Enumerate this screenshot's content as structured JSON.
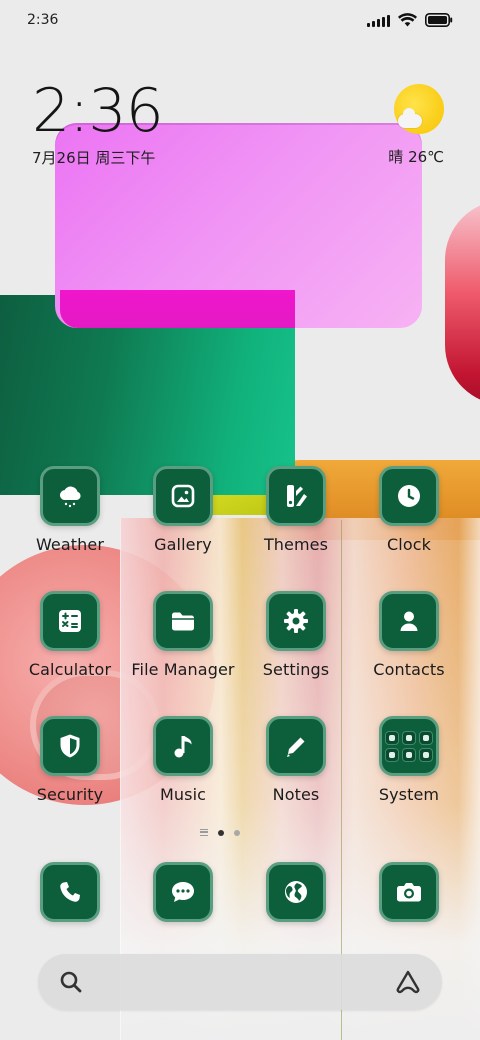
{
  "status_bar": {
    "time": "2:36"
  },
  "clock_widget": {
    "time": "2:36",
    "date": "7月26日 周三下午"
  },
  "weather_widget": {
    "text": "晴 26℃"
  },
  "apps": {
    "weather": "Weather",
    "gallery": "Gallery",
    "themes": "Themes",
    "clock": "Clock",
    "calculator": "Calculator",
    "file_manager": "File Manager",
    "settings": "Settings",
    "contacts": "Contacts",
    "security": "Security",
    "music": "Music",
    "notes": "Notes",
    "system": "System"
  },
  "page_indicator": {
    "pages": 2,
    "current": 1
  },
  "dock": [
    "phone-icon",
    "messages-icon",
    "browser-icon",
    "camera-icon"
  ],
  "colors": {
    "icon_bg": "#0d5e3b",
    "icon_border": "#5a9e82",
    "icon_glyph": "#ffffff"
  }
}
